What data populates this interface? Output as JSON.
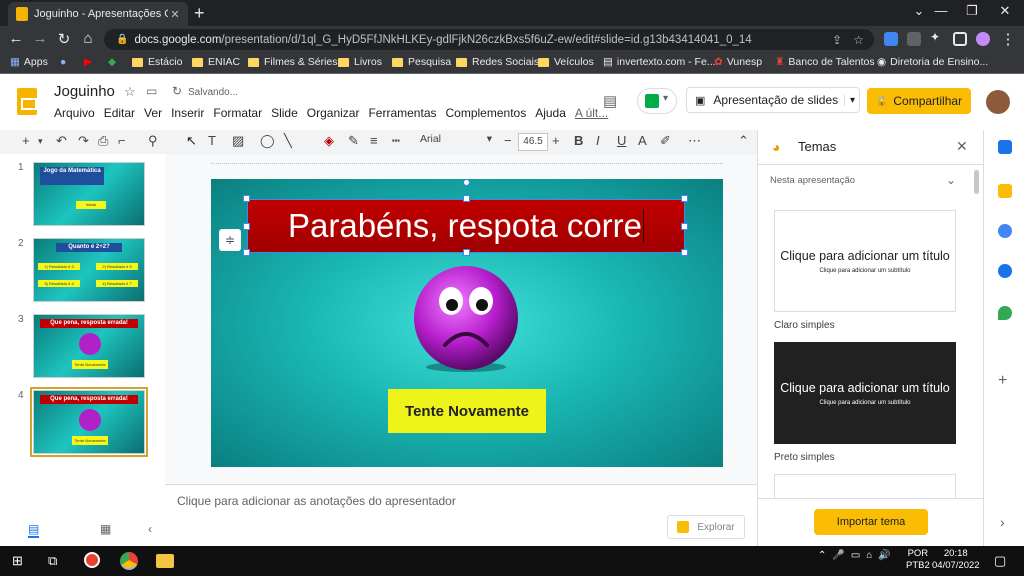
{
  "browser": {
    "tab_title": "Joguinho - Apresentações Goog",
    "url_host": "docs.google.com",
    "url_path": "/presentation/d/1ql_G_HyD5FfJNkHLKEy-gdlFjkN26czkBxs5f6uZ-ew/edit#slide=id.g13b43414041_0_14"
  },
  "bookmarks": [
    {
      "label": "Apps",
      "icon": "apps-grid-icon"
    },
    {
      "label": "",
      "icon": "people-icon"
    },
    {
      "label": "",
      "icon": "youtube-icon"
    },
    {
      "label": "",
      "icon": "maps-icon"
    },
    {
      "label": "Estácio",
      "icon": "folder-icon"
    },
    {
      "label": "ENIAC",
      "icon": "folder-icon"
    },
    {
      "label": "Filmes & Séries",
      "icon": "folder-icon"
    },
    {
      "label": "Livros",
      "icon": "folder-icon"
    },
    {
      "label": "Pesquisa",
      "icon": "folder-icon"
    },
    {
      "label": "Redes Sociais",
      "icon": "folder-icon"
    },
    {
      "label": "Veículos",
      "icon": "folder-icon"
    },
    {
      "label": "invertexto.com - Fe...",
      "icon": "document-icon"
    },
    {
      "label": "Vunesp",
      "icon": "vunesp-icon"
    },
    {
      "label": "Banco de Talentos",
      "icon": "bank-icon"
    },
    {
      "label": "Diretoria de Ensino...",
      "icon": "globe-icon"
    }
  ],
  "header": {
    "doc_title": "Joguinho",
    "saving": "Salvando...",
    "menus": [
      "Arquivo",
      "Editar",
      "Ver",
      "Inserir",
      "Formatar",
      "Slide",
      "Organizar",
      "Ferramentas",
      "Complementos",
      "Ajuda"
    ],
    "last_edit": "A últ...",
    "present_label": "Apresentação de slides",
    "share_label": "Compartilhar"
  },
  "toolbar": {
    "font": "Arial",
    "font_size": "46.5",
    "bold": "B",
    "italic": "I",
    "underline": "U",
    "text_color": "A"
  },
  "slides": [
    {
      "num": "1",
      "title": "Jogo da Matemática",
      "button": "Iniciar"
    },
    {
      "num": "2",
      "title": "Quanto é 2+2?",
      "options": [
        "1) Resultado é 3",
        "2) Resultado é 5",
        "3) Resultado é 4",
        "4) Resultado é 7"
      ]
    },
    {
      "num": "3",
      "title": "Que pena, resposta errada!",
      "button": "Tente Novamente"
    },
    {
      "num": "4",
      "title": "Que pena, resposta errada!",
      "button": "Tente Novamente"
    }
  ],
  "current_slide": {
    "title_text": "Parabéns, respota corre",
    "button_text": "Tente Novamente"
  },
  "notes_placeholder": "Clique para adicionar as anotações do apresentador",
  "explore_label": "Explorar",
  "themes_panel": {
    "title": "Temas",
    "section": "Nesta apresentação",
    "themes": [
      {
        "name": "Claro simples",
        "title": "Clique para adicionar um título",
        "subtitle": "Clique para adicionar um subtítulo",
        "bg": "#ffffff",
        "fg": "#202124"
      },
      {
        "name": "Preto simples",
        "title": "Clique para adicionar um título",
        "subtitle": "Clique para adicionar um subtítulo",
        "bg": "#212121",
        "fg": "#ffffff"
      }
    ],
    "import_label": "Importar tema"
  },
  "taskbar": {
    "lang_top": "POR",
    "lang_bottom": "PTB2",
    "time": "20:18",
    "date": "04/07/2022"
  },
  "colors": {
    "accent_yellow": "#fbbc04",
    "slide_teal": "#19b6b3",
    "title_red": "#c00000",
    "button_yellow": "#eef41a"
  }
}
